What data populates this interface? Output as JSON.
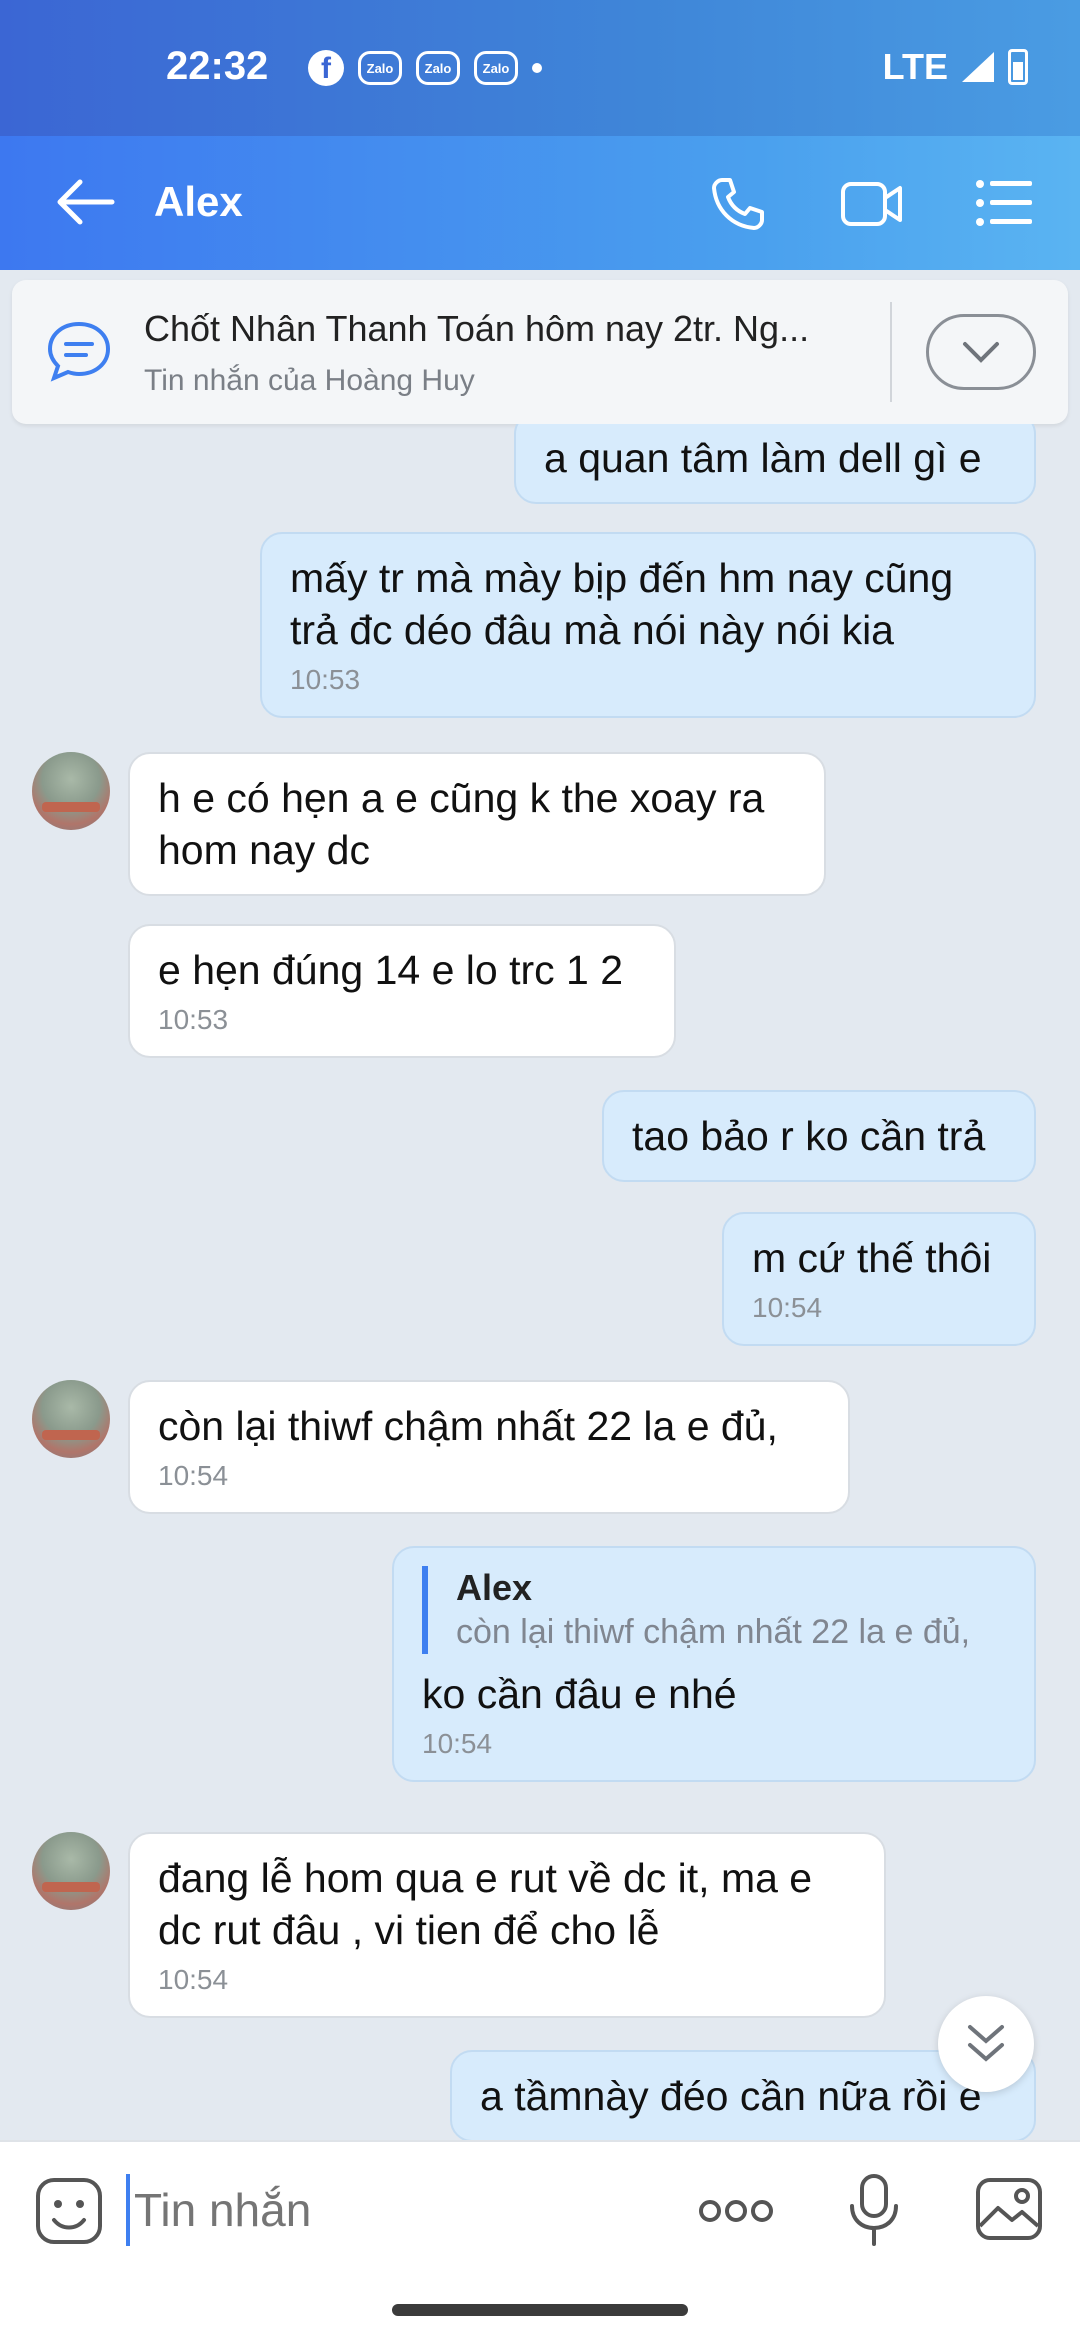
{
  "status_bar": {
    "time": "22:32",
    "fb_glyph": "f",
    "zalo_label": "Zalo",
    "network": "LTE"
  },
  "header": {
    "title": "Alex",
    "icons": [
      "back-arrow-icon",
      "phone-call-icon",
      "video-call-icon",
      "menu-list-icon"
    ]
  },
  "pinned": {
    "title": "Chốt Nhân Thanh Toán hôm nay 2tr. Ng...",
    "subtitle": "Tin nhắn của Hoàng Huy"
  },
  "messages": [
    {
      "dir": "out",
      "text": "a quan tâm làm dell gì e",
      "time": ""
    },
    {
      "dir": "out",
      "text": "mấy tr mà mày bịp đến hm nay cũng\ntrả đc déo đâu mà nói này nói kia",
      "time": "10:53"
    },
    {
      "dir": "in",
      "text": "h e có hẹn a e cũng k the xoay ra\nhom nay dc",
      "time": ""
    },
    {
      "dir": "in",
      "text": "e hẹn đúng 14 e lo trc 1 2",
      "time": "10:53"
    },
    {
      "dir": "out",
      "text": "tao bảo r ko cần trả",
      "time": ""
    },
    {
      "dir": "out",
      "text": "m cứ thế thôi",
      "time": "10:54"
    },
    {
      "dir": "in",
      "text": "còn lại thiwf chậm nhất 22 la e đủ,",
      "time": "10:54"
    },
    {
      "dir": "out",
      "text": "ko cần đâu e nhé",
      "time": "10:54",
      "quote": {
        "name": "Alex",
        "text": "còn lại thiwf chậm nhất 22 la e đủ,"
      }
    },
    {
      "dir": "in",
      "text": "đang lễ hom qua e rut về dc it, ma e\ndc rut đâu , vi tien để cho lễ",
      "time": "10:54"
    },
    {
      "dir": "out",
      "text": "a tầmnày đéo cần nữa rồi e",
      "time": ""
    }
  ],
  "input": {
    "placeholder": "Tin nhắn"
  },
  "colors": {
    "accent": "#3e7ff0",
    "outgoing_bubble": "#d7ebfc",
    "incoming_bubble": "#ffffff",
    "chat_bg": "#e3e9f0"
  }
}
